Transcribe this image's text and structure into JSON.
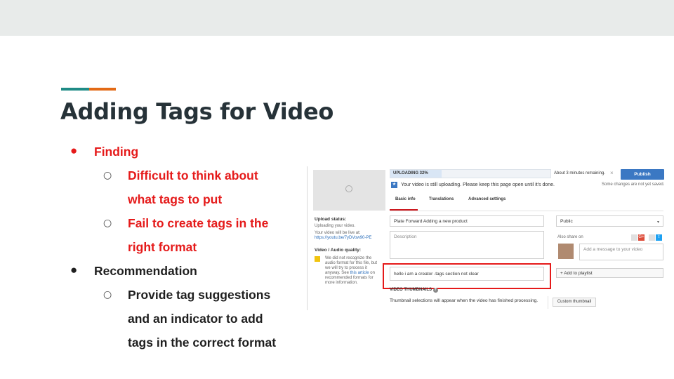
{
  "slide": {
    "title": "Adding Tags for Video",
    "bullets": [
      {
        "text": "Finding",
        "color": "#e51a1a"
      },
      {
        "text": "Difficult to think about",
        "color": "#e51a1a"
      },
      {
        "text": "what tags to put",
        "color": "#e51a1a"
      },
      {
        "text": "Fail to create tags in the",
        "color": "#e51a1a"
      },
      {
        "text": "right format",
        "color": "#e51a1a"
      },
      {
        "text": "Recommendation",
        "color": "#1f1f1f"
      },
      {
        "text": "Provide tag suggestions",
        "color": "#1f1f1f"
      },
      {
        "text": "and an indicator to add",
        "color": "#1f1f1f"
      },
      {
        "text": "tags in the correct format",
        "color": "#1f1f1f"
      }
    ],
    "accent_colors": [
      "#1f8b86",
      "#e36a16"
    ]
  },
  "screenshot": {
    "upload_bar": {
      "label": "UPLOADING 32%",
      "progress": 0.32
    },
    "time_remaining": "About 3 minutes remaining.",
    "close_glyph": "×",
    "publish_label": "Publish",
    "info_message": "Your video is still uploading. Please keep this page open until it's done.",
    "not_saved": "Some changes are not yet saved.",
    "tabs": [
      "Basic info",
      "Translations",
      "Advanced settings"
    ],
    "upload_status": {
      "heading": "Upload status:",
      "line1": "Uploading your video.",
      "line2": "Your video will be live at:",
      "url": "https://youtu.be/7yDVow90-PE"
    },
    "quality": {
      "heading": "Video / Audio quality:",
      "warn_lines": [
        "We did not recognize the",
        "audio format for this file, but",
        "we will try to process it",
        "anyway. See",
        "recommended formats for",
        "more information."
      ],
      "warn_link": "this article",
      "warn_after_link": "on"
    },
    "title_value": "Plate Forward  Adding a new product",
    "description_placeholder": "Description",
    "tags_value": "hello i am a creator -tags section not clear",
    "privacy_value": "Public",
    "also_share": "Also share on",
    "message_placeholder": "Add a message to your video",
    "add_playlist": "+ Add to playlist",
    "thumbnails_header": "VIDEO THUMBNAILS",
    "thumbnails_text": "Thumbnail selections will appear when the video has finished processing.",
    "custom_thumbnail": "Custom thumbnail",
    "social": {
      "gplus": "G+",
      "twitter": "t"
    },
    "brand_colors": {
      "publish": "#3b78c3",
      "highlight": "#e51a1a",
      "gplus": "#dd4b39",
      "twitter": "#1da1f2"
    }
  }
}
